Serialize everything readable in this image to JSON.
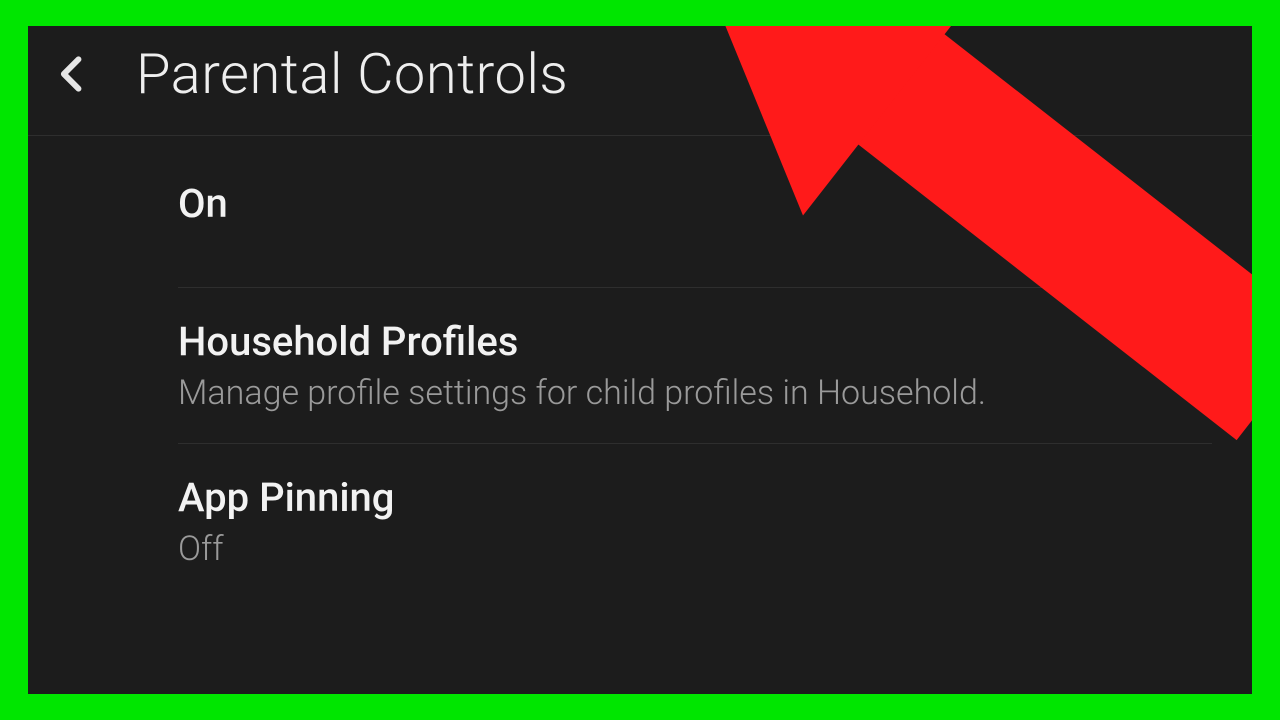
{
  "header": {
    "title": "Parental Controls"
  },
  "rows": {
    "status": {
      "label": "On"
    },
    "household": {
      "title": "Household Profiles",
      "desc": "Manage profile settings for child profiles in Household."
    },
    "pinning": {
      "title": "App Pinning",
      "value": "Off"
    }
  },
  "annotation": {
    "arrow_color": "#ff1a1a"
  }
}
